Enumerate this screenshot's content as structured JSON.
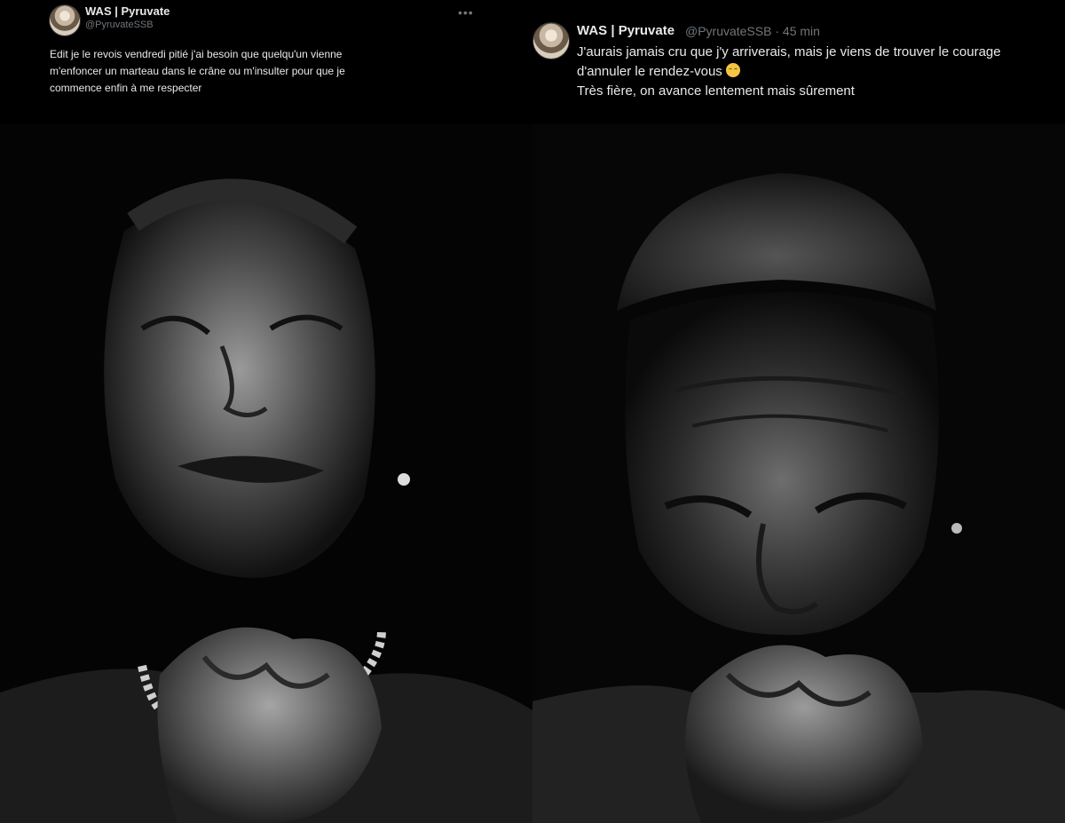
{
  "left_tweet": {
    "name": "WAS | Pyruvate",
    "handle": "@PyruvateSSB",
    "more_icon": "more-dots-icon",
    "text": "Edit je le revois vendredi pitié j'ai besoin que quelqu'un vienne\nm'enfoncer un marteau dans le crâne ou m'insulter pour  que je\ncommence enfin à me respecter"
  },
  "right_tweet": {
    "name": "WAS | Pyruvate",
    "meta": "@PyruvateSSB · 45 min",
    "text_line1": "J'aurais jamais cru que j'y arriverais, mais je viens de trouver le courage",
    "text_line2": "d'annuler le rendez-vous",
    "emoji": "relieved-face-icon",
    "text_line3": "Très fière, on avance lentement mais sûrement"
  },
  "colors": {
    "background": "#000000",
    "text": "#e7e9ea",
    "secondary": "#71767b"
  }
}
